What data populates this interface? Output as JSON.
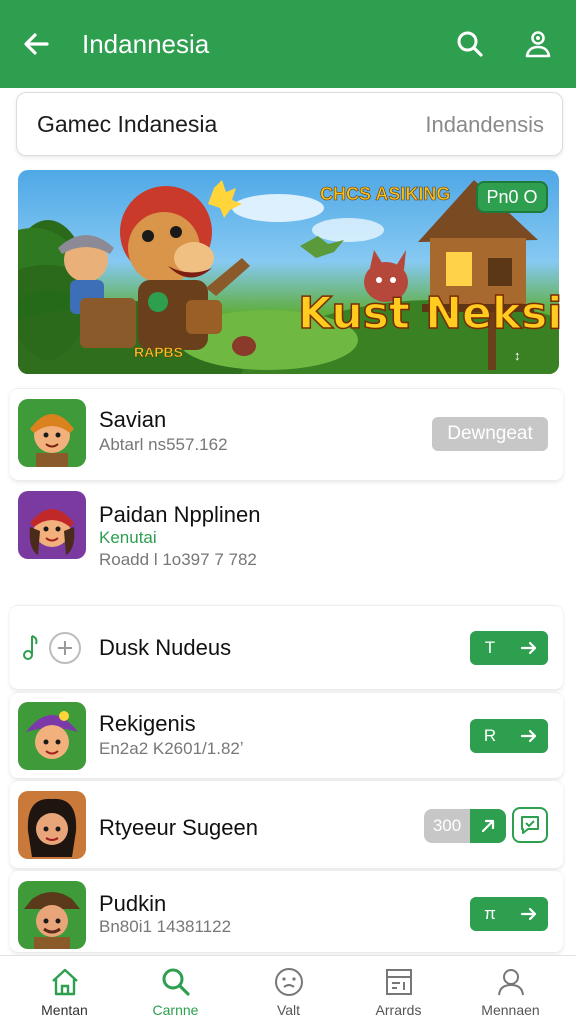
{
  "header": {
    "title": "Indannesia"
  },
  "search": {
    "label": "Gamec Indanesia",
    "hint": "Indandensis"
  },
  "banner": {
    "subtitle": "CHCS ASIKING",
    "title": "Kust Neksi",
    "badge": "Pn0 O",
    "small_text": "RAPBS",
    "mute": "↕"
  },
  "rows": [
    {
      "name": "Savian",
      "sub": "Abtarl ns557.162",
      "button": "Dewngeat"
    },
    {
      "name": "Paidan Npplinen",
      "tag": "Kenutai",
      "sub": "Roadd l 1o397 7 782"
    },
    {
      "name": "Dusk Nudeus",
      "button_left": "T"
    },
    {
      "name": "Rekigenis",
      "sub": "En2a2 K2601/1.82ʼ",
      "button_left": "R"
    },
    {
      "name": "Rtyeeur Sugeen",
      "button_left": "300"
    },
    {
      "name": "Pudkin",
      "sub": "Bn80i1 14381122",
      "button_left": "π"
    }
  ],
  "nav": {
    "items": [
      {
        "label": "Mentan",
        "icon": "home-icon"
      },
      {
        "label": "Carnne",
        "icon": "search-icon"
      },
      {
        "label": "Valt",
        "icon": "smiley-icon"
      },
      {
        "label": "Arrards",
        "icon": "awards-icon"
      },
      {
        "label": "Mennaen",
        "icon": "person-icon"
      }
    ],
    "active_index": 1
  },
  "colors": {
    "primary": "#2e9e4f",
    "disabled": "#c7c7c7",
    "banner_title": "#ffcc1f"
  }
}
